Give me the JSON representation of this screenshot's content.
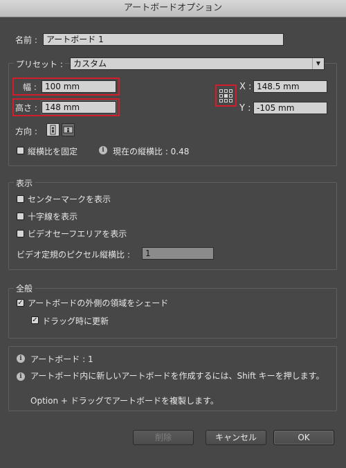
{
  "window": {
    "title": "アートボードオプション"
  },
  "name": {
    "label": "名前 :",
    "value": "アートボード 1"
  },
  "preset": {
    "label": "プリセット :",
    "value": "カスタム"
  },
  "width": {
    "label": "幅 :",
    "value": "100 mm"
  },
  "height": {
    "label": "高さ :",
    "value": "148 mm"
  },
  "x": {
    "label": "X :",
    "value": "148.5 mm"
  },
  "y": {
    "label": "Y :",
    "value": "-105 mm"
  },
  "orientation": {
    "label": "方向 :"
  },
  "constrain": {
    "label": "縦横比を固定",
    "checked": false
  },
  "ratio": {
    "text": "現在の縦横比 : 0.48"
  },
  "display": {
    "title": "表示",
    "center_mark": "センターマークを表示",
    "cross_hairs": "十字線を表示",
    "video_safe": "ビデオセーフエリアを表示",
    "video_ruler_label": "ビデオ定規のピクセル縦横比 :",
    "video_ruler_value": "1"
  },
  "global": {
    "title": "全般",
    "fade_outside": "アートボードの外側の領域をシェード",
    "update_drag": "ドラッグ時に更新"
  },
  "info": {
    "artboards": "アートボード : 1",
    "tip1": "アートボード内に新しいアートボードを作成するには、Shift キーを押します。",
    "tip2": "Option + ドラッグでアートボードを複製します。"
  },
  "buttons": {
    "delete": "削除",
    "cancel": "キャンセル",
    "ok": "OK"
  },
  "colors": {
    "highlight": "#d41c2a",
    "dialog_bg": "#474747"
  }
}
